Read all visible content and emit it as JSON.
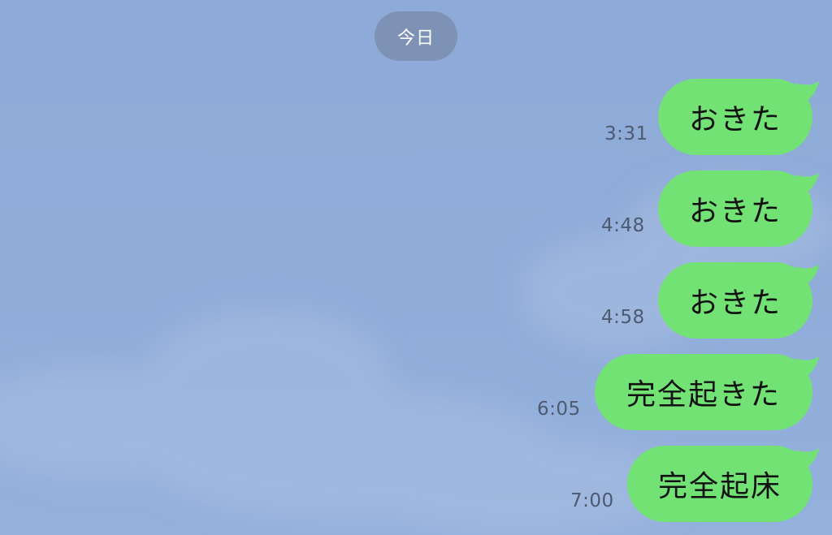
{
  "chat": {
    "date_divider": "今日",
    "colors": {
      "background": "#8fabd9",
      "outgoing_bubble": "#72e275",
      "date_pill": "#7d92b5",
      "timestamp_text": "#4d5a70"
    },
    "messages": [
      {
        "text": "おきた",
        "time": "3:31",
        "sender": "me"
      },
      {
        "text": "おきた",
        "time": "4:48",
        "sender": "me"
      },
      {
        "text": "おきた",
        "time": "4:58",
        "sender": "me"
      },
      {
        "text": "完全起きた",
        "time": "6:05",
        "sender": "me"
      },
      {
        "text": "完全起床",
        "time": "7:00",
        "sender": "me"
      }
    ]
  }
}
